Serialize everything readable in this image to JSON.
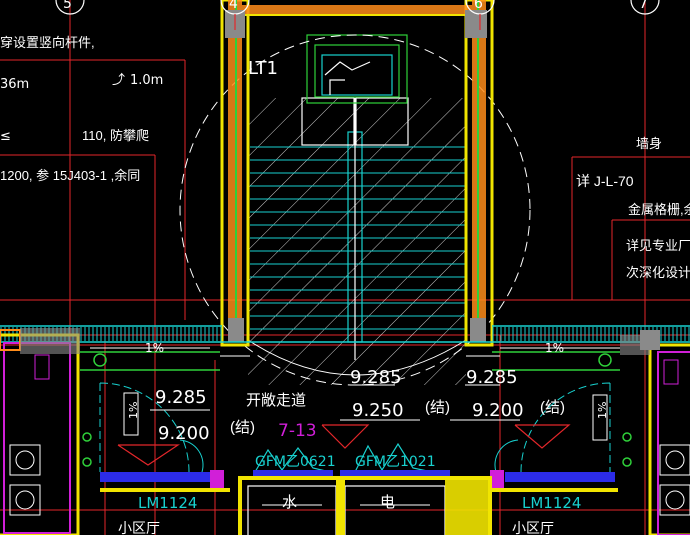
{
  "colors": {
    "background": "#000000",
    "white": "#ffffff",
    "red": "#e3262a",
    "yellow": "#f1e400",
    "orange": "#ff8c1a",
    "green": "#2fd13a",
    "cyan": "#18d1cf",
    "magenta": "#d11fd8",
    "blue": "#2c2ce8",
    "pink": "#ff6ad5",
    "gray": "#8a8a8a"
  },
  "grid_bubbles": [
    "5",
    "4",
    "6",
    "7"
  ],
  "labels": {
    "left_note_1": "穿设置竖向杆件,",
    "left_dim_1": "36m",
    "left_dim_2": "1.0m",
    "left_symbol": "≤",
    "left_note_2": "110, 防攀爬",
    "left_note_3": "1200, 参 15J403-1  ,余同",
    "stair_tag": "LT1",
    "right_note_1": "墙身",
    "right_note_2": "详 J-L-70",
    "right_note_3": "金属格栅,余同",
    "right_note_4": "详见专业厂家二",
    "right_note_5": "次深化设计",
    "slope_left": "1%",
    "slope_right": "1%",
    "slope_vert_left": "1%",
    "slope_vert_right": "1%",
    "elev_stair": "9.285",
    "elev_right": "9.285",
    "elev_left_1": "9.285",
    "elev_left_2": "9.200",
    "elev_left_struct": "(结)",
    "corridor_label": "开敞走道",
    "corridor_no": "7-13",
    "elev_mid": "9.250",
    "elev_mid_struct": "(结)",
    "elev_right_2": "9.200",
    "elev_right_struct": "(结)",
    "door_1": "GFM乙0621",
    "door_2": "GFM乙1021",
    "shaft_water": "水",
    "shaft_elec": "电",
    "door_left": "LM1124",
    "door_right": "LM1124",
    "room_left": "小区厅",
    "room_right": "小区厅"
  }
}
